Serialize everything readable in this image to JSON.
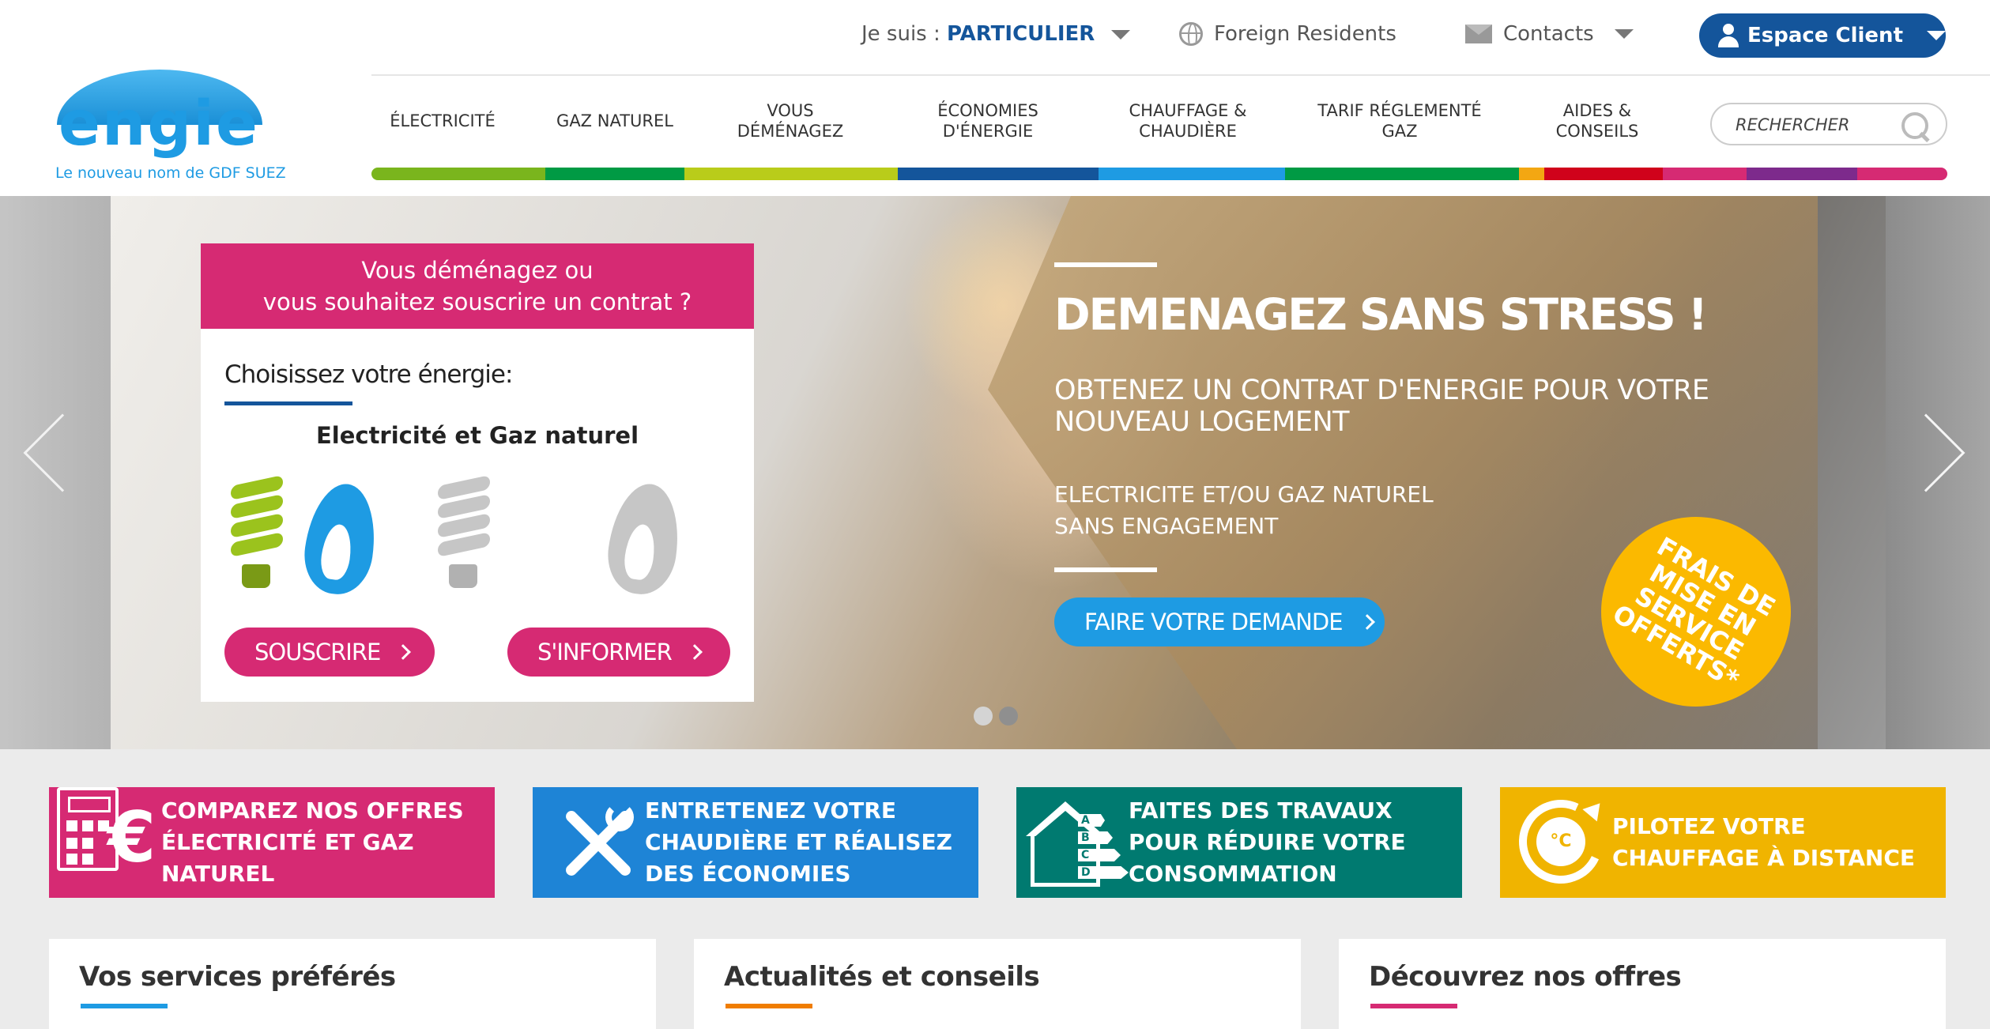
{
  "brand": {
    "logo_text": "engie",
    "tagline": "Le nouveau nom de GDF SUEZ"
  },
  "topbar": {
    "je_suis_label": "Je suis :",
    "je_suis_value": "PARTICULIER",
    "foreign": "Foreign Residents",
    "contacts": "Contacts",
    "espace_client": "Espace Client"
  },
  "nav": {
    "items": [
      {
        "label": "ÉLECTRICITÉ",
        "color": "#7ab51d"
      },
      {
        "label": "GAZ NATUREL",
        "color": "#009a44"
      },
      {
        "label": "VOUS DÉMÉNAGEZ",
        "color": "#b9cc1a"
      },
      {
        "label": "ÉCONOMIES D'ÉNERGIE",
        "color": "#14559b"
      },
      {
        "label": "CHAUFFAGE & CHAUDIÈRE",
        "color": "#1e9be3"
      },
      {
        "label": "TARIF RÉGLEMENTÉ GAZ",
        "color": "#009a44"
      },
      {
        "label": "AIDES & CONSEILS",
        "color": "#d62a73"
      }
    ],
    "search_placeholder": "RECHERCHER"
  },
  "hero": {
    "card_heading_line1": "Vous déménagez ou",
    "card_heading_line2": "vous souhaitez souscrire un contrat ?",
    "card_subtitle": "Choisissez votre énergie:",
    "card_choice": "Electricité et Gaz naturel",
    "btn_souscrire": "SOUSCRIRE",
    "btn_informer": "S'INFORMER",
    "title": "DEMENAGEZ SANS STRESS !",
    "subtitle_line1": "OBTENEZ UN CONTRAT D'ENERGIE POUR VOTRE",
    "subtitle_line2": "NOUVEAU LOGEMENT",
    "sub2_line1": "ELECTRICITE ET/OU GAZ NATUREL",
    "sub2_line2": "SANS ENGAGEMENT",
    "cta": "FAIRE VOTRE DEMANDE",
    "badge_line1": "FRAIS DE",
    "badge_line2": "MISE EN",
    "badge_line3": "SERVICE",
    "badge_line4": "OFFERTS*"
  },
  "tiles": [
    {
      "label": "COMPAREZ NOS OFFRES ÉLECTRICITÉ ET GAZ NATUREL",
      "color": "#d62a73",
      "icon": "calculator-euro-icon"
    },
    {
      "label": "ENTRETENEZ VOTRE CHAUDIÈRE ET RÉALISEZ DES ÉCONOMIES",
      "color": "#1e84d6",
      "icon": "tools-icon"
    },
    {
      "label": "FAITES DES TRAVAUX POUR RÉDUIRE VOTRE CONSOMMATION",
      "color": "#007a70",
      "icon": "energy-label-house-icon"
    },
    {
      "label": "PILOTEZ VOTRE CHAUFFAGE À DISTANCE",
      "color": "#f0b400",
      "icon": "thermostat-icon"
    }
  ],
  "energy_grades": [
    "A",
    "B",
    "C",
    "D"
  ],
  "thermostat_unit": "°C",
  "panels": [
    {
      "title": "Vos services préférés",
      "color": "#1e9be3"
    },
    {
      "title": "Actualités et conseils",
      "color": "#f07d00"
    },
    {
      "title": "Découvrez nos offres",
      "color": "#d62a73"
    }
  ]
}
